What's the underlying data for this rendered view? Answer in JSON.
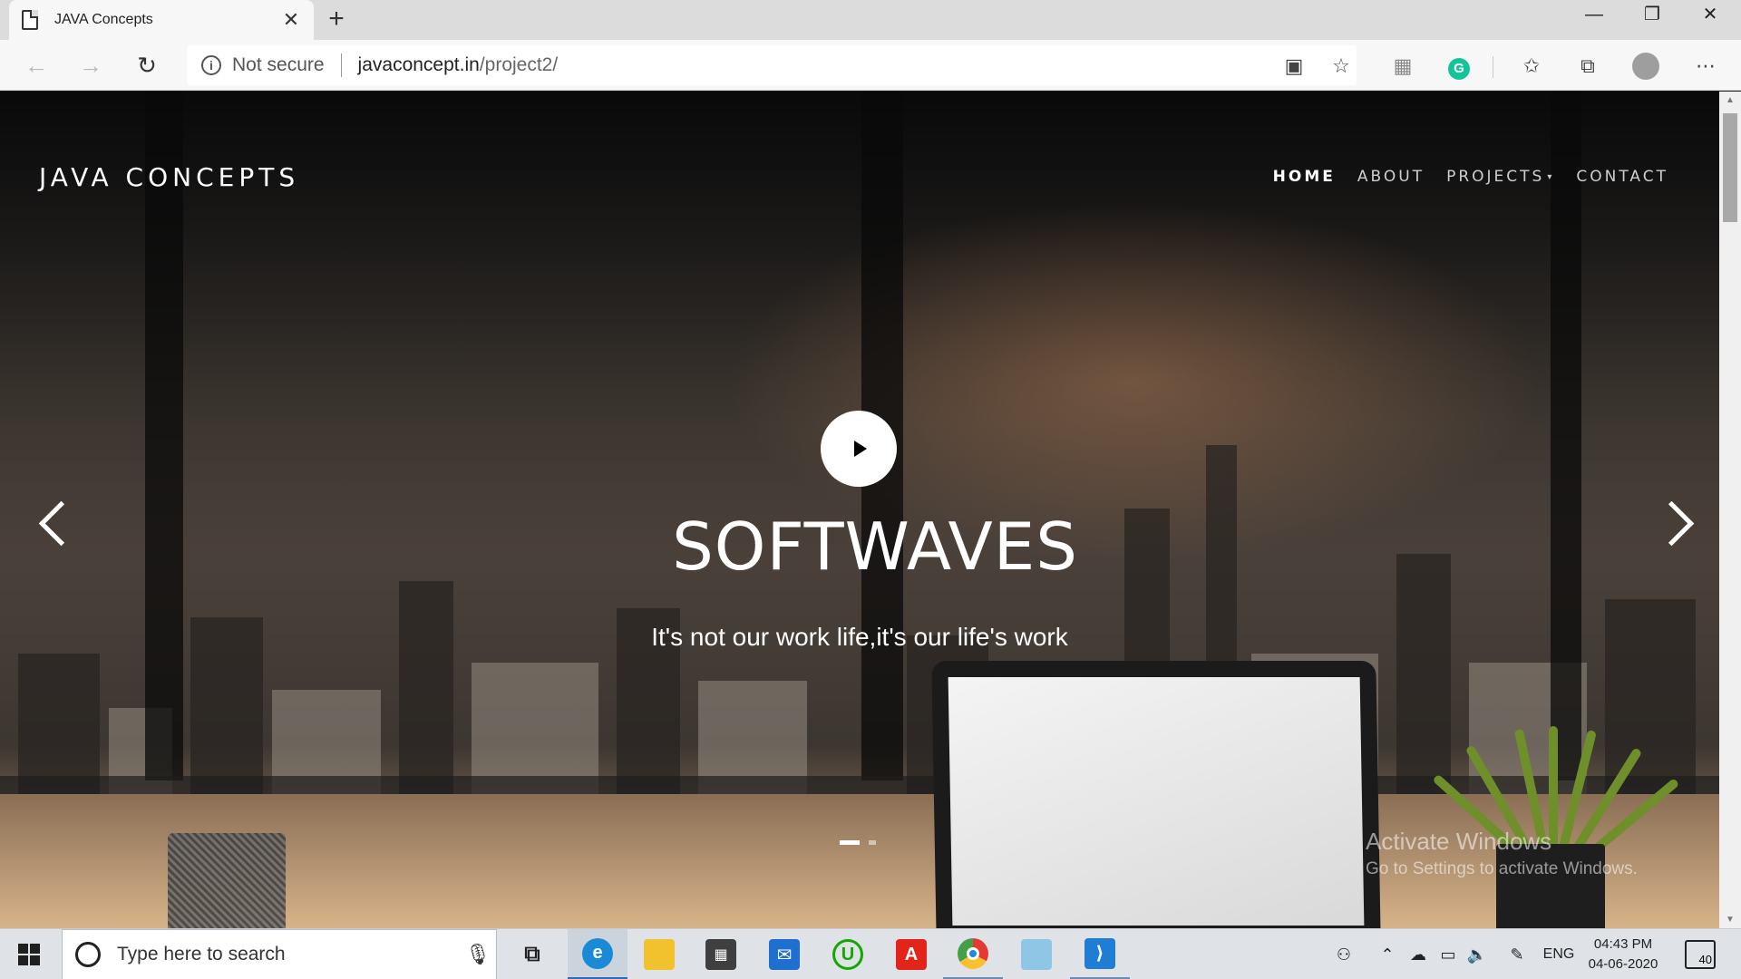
{
  "browser": {
    "tab_title": "JAVA Concepts",
    "tab_close": "✕",
    "new_tab": "+",
    "security_label": "Not secure",
    "url_host": "javaconcept.in",
    "url_path": "/project2/",
    "window_controls": {
      "minimize": "—",
      "restore": "❐",
      "close": "✕"
    }
  },
  "site": {
    "brand": "JAVA CONCEPTS",
    "nav": [
      {
        "label": "HOME",
        "active": true
      },
      {
        "label": "ABOUT",
        "active": false
      },
      {
        "label": "PROJECTS",
        "active": false
      },
      {
        "label": "CONTACT",
        "active": false
      }
    ],
    "projects_caret": "▾",
    "hero_title": "SOFTWAVES",
    "hero_subtitle": "It's not our work life,it's our life's work",
    "carousel": {
      "slide_count": 2,
      "active_slide": 1
    }
  },
  "watermark": {
    "line1": "Activate Windows",
    "line2": "Go to Settings to activate Windows."
  },
  "taskbar": {
    "search_placeholder": "Type here to search",
    "language": "ENG",
    "time": "04:43 PM",
    "date": "04-06-2020",
    "notifications_count": "40",
    "apps": [
      "task-view",
      "edge",
      "file-explorer",
      "microsoft-store",
      "mail",
      "upwork",
      "acrobat-reader",
      "chrome",
      "notepad",
      "vscode"
    ]
  },
  "colors": {
    "edge_blue": "#1b8ad6",
    "grammarly_green": "#15c39a",
    "acrobat_red": "#e3241b",
    "vscode_blue": "#1f7ed4",
    "upwork_green": "#14a800"
  }
}
